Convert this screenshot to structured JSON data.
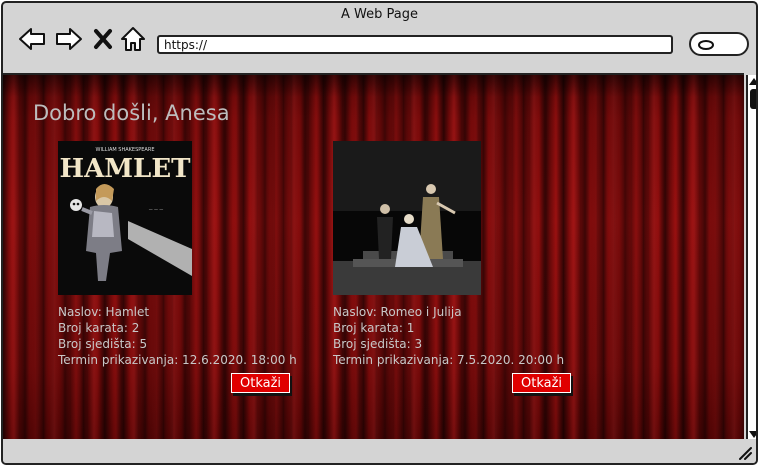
{
  "window": {
    "title": "A Web Page"
  },
  "address_bar": {
    "url": "https://"
  },
  "icons": {
    "back": "back-arrow-icon",
    "forward": "forward-arrow-icon",
    "stop": "close-icon",
    "home": "home-icon",
    "search": "search-icon"
  },
  "colors": {
    "curtain": "#8e0d0d",
    "button": "#e00000",
    "text": "#c8c8c8"
  },
  "page": {
    "welcome": "Dobro došli, Anesa",
    "reservations": [
      {
        "title_line": "Naslov: Hamlet",
        "tickets_line": "Broj karata: 2",
        "seats_line": "Broj sjedišta: 5",
        "showtime_line": "Termin prikazivanja: 12.6.2020. 18:00 h",
        "poster_text": "HAMLET",
        "cancel_label": "Otkaži"
      },
      {
        "title_line": "Naslov: Romeo i Julija",
        "tickets_line": "Broj karata: 1",
        "seats_line": "Broj sjedišta: 3",
        "showtime_line": "Termin prikazivanja: 7.5.2020. 20:00 h",
        "cancel_label": "Otkaži"
      }
    ]
  }
}
